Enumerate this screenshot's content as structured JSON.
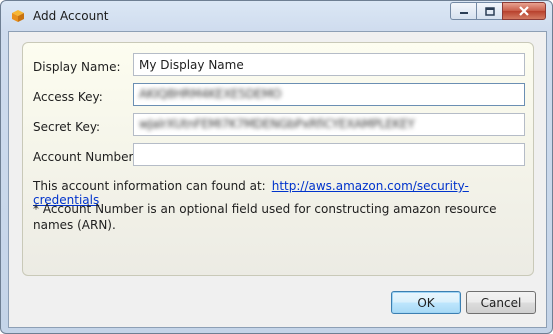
{
  "window": {
    "title": "Add Account",
    "icon": "orange-cube-icon"
  },
  "form": {
    "display_name": {
      "label": "Display Name:",
      "value": "My Display Name"
    },
    "access_key": {
      "label": "Access Key:",
      "value": "AKIQ8HRM4KEXE5DEMO"
    },
    "secret_key": {
      "label": "Secret Key:",
      "value": "wJalrXUtnFEMI7K7MDENGbPxRfiCYEXAMPLEKEY"
    },
    "account_number": {
      "label": "Account Number*",
      "value": ""
    }
  },
  "info": {
    "text": "This account information can found at:",
    "link": "http://aws.amazon.com/security-credentials"
  },
  "note": "* Account Number is an optional field used for constructing amazon resource names (ARN).",
  "buttons": {
    "ok": "OK",
    "cancel": "Cancel"
  },
  "colors": {
    "link": "#0033cc",
    "close_button": "#c85c48",
    "default_button_border": "#3c7fb1"
  }
}
